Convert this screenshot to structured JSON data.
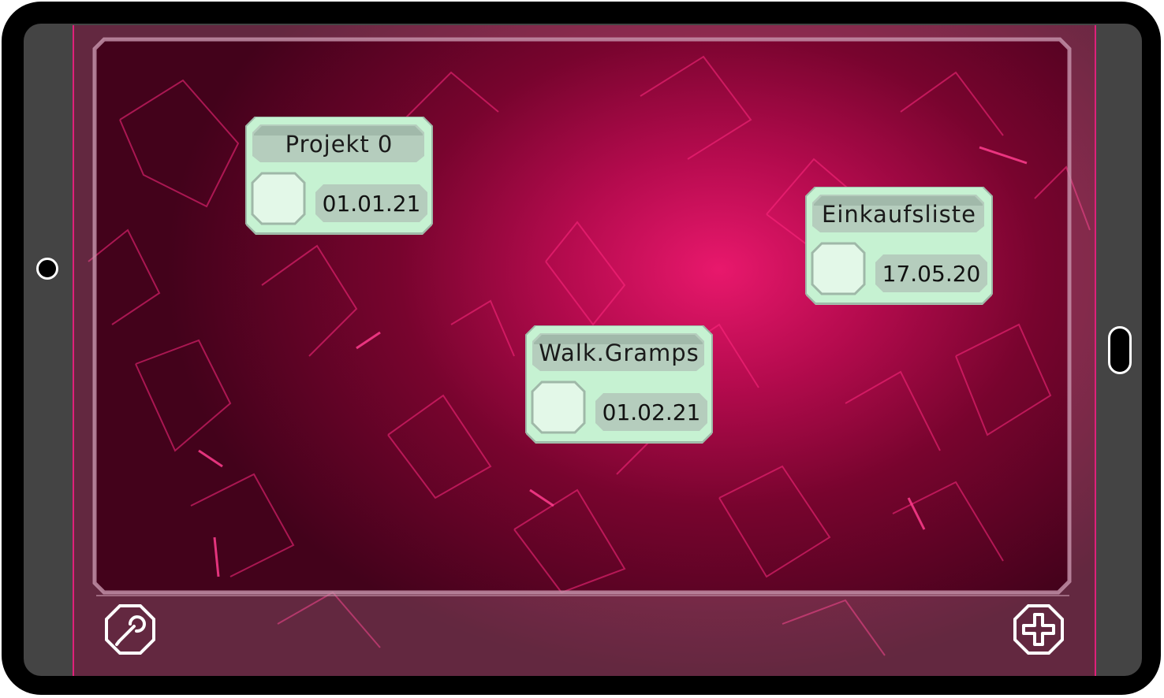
{
  "colors": {
    "card_fill": "#c6f2d2",
    "card_accent": "#a9c3b2",
    "background_center": "#e8186c",
    "background_edge": "#43021b",
    "frame": "#444444"
  },
  "cards": [
    {
      "title": "Projekt 0",
      "date": "01.01.21",
      "icon": "octagon-checkbox"
    },
    {
      "title": "Einkaufsliste",
      "date": "17.05.20",
      "icon": "octagon-checkbox"
    },
    {
      "title": "Walk.Gramps",
      "date": "01.02.21",
      "icon": "octagon-checkbox"
    }
  ],
  "toolbar": {
    "left_icon": "wrench-icon",
    "right_icon": "plus-icon"
  }
}
